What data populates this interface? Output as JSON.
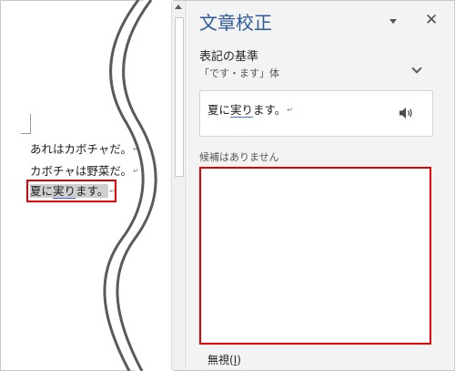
{
  "document": {
    "lines": [
      {
        "text": "あれはカボチャだ。",
        "mark": "↵"
      },
      {
        "text": "カボチャは野菜だ。",
        "mark": "↵"
      },
      {
        "pre": "夏に",
        "underlined": "実り",
        "post": "ます。",
        "mark": "↵"
      }
    ]
  },
  "pane": {
    "title": "文章校正",
    "close_label": "✕",
    "section_label": "表記の基準",
    "style_value": "「です・ます」体",
    "suggestion": {
      "pre": "夏に",
      "underlined": "実り",
      "post": "ます。",
      "mark": "↵"
    },
    "no_candidates": "候補はありません",
    "ignore": {
      "label": "無視(",
      "key": "I",
      "suffix": ")"
    }
  },
  "icons": {
    "pane_menu": "chevron-down-icon",
    "close": "close-icon",
    "expand": "chevron-down-icon",
    "speaker": "speaker-icon"
  },
  "colors": {
    "title": "#2d5a9a",
    "highlight_box": "#e00000",
    "underline": "#3f6fd8",
    "pane_bg": "#f3f3f3"
  }
}
